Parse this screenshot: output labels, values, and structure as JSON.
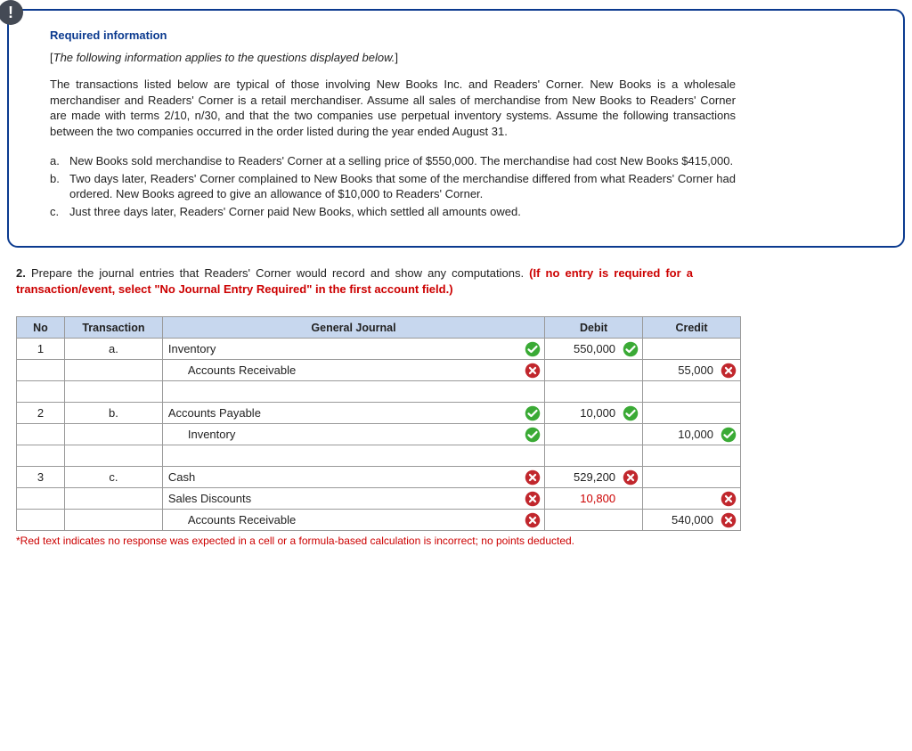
{
  "info": {
    "badge": "!",
    "heading": "Required information",
    "applies_prefix": "[",
    "applies": "The following information applies to the questions displayed below.",
    "applies_suffix": "]",
    "body": "The transactions listed below are typical of those involving New Books Inc. and Readers' Corner. New Books is a wholesale merchandiser and Readers' Corner is a retail merchandiser. Assume all sales of merchandise from New Books to Readers' Corner are made with terms 2/10, n/30, and that the two companies use perpetual inventory systems. Assume the following transactions between the two companies occurred in the order listed during the year ended August 31.",
    "items": [
      {
        "mk": "a.",
        "text": "New Books sold merchandise to Readers' Corner at a selling price of $550,000. The merchandise had cost New Books $415,000."
      },
      {
        "mk": "b.",
        "text": "Two days later, Readers' Corner complained to New Books that some of the merchandise differed from what Readers' Corner had ordered. New Books agreed to give an allowance of $10,000 to Readers' Corner."
      },
      {
        "mk": "c.",
        "text": "Just three days later, Readers' Corner paid New Books, which settled all amounts owed."
      }
    ]
  },
  "question": {
    "num": "2.",
    "text": "Prepare the journal entries that Readers' Corner would record and show any computations. ",
    "hint": "(If no entry is required for a transaction/event, select \"No Journal Entry Required\" in the first account field.)"
  },
  "table": {
    "headers": {
      "no": "No",
      "tx": "Transaction",
      "gj": "General Journal",
      "debit": "Debit",
      "credit": "Credit"
    },
    "rows": [
      {
        "no": "1",
        "tx": "a.",
        "account": "Inventory",
        "indent": false,
        "gmark": "check",
        "debit": "550,000",
        "dmark": "check",
        "credit": "",
        "cmark": ""
      },
      {
        "no": "",
        "tx": "",
        "account": "Accounts Receivable",
        "indent": true,
        "gmark": "x",
        "debit": "",
        "dmark": "",
        "credit": "55,000",
        "cmark": "x"
      },
      {
        "no": "",
        "tx": "",
        "account": "",
        "indent": false,
        "gmark": "",
        "debit": "",
        "dmark": "",
        "credit": "",
        "cmark": ""
      },
      {
        "no": "2",
        "tx": "b.",
        "account": "Accounts Payable",
        "indent": false,
        "gmark": "check",
        "debit": "10,000",
        "dmark": "check",
        "credit": "",
        "cmark": ""
      },
      {
        "no": "",
        "tx": "",
        "account": "Inventory",
        "indent": true,
        "gmark": "check",
        "debit": "",
        "dmark": "",
        "credit": "10,000",
        "cmark": "check"
      },
      {
        "no": "",
        "tx": "",
        "account": "",
        "indent": false,
        "gmark": "",
        "debit": "",
        "dmark": "",
        "credit": "",
        "cmark": ""
      },
      {
        "no": "3",
        "tx": "c.",
        "account": "Cash",
        "indent": false,
        "gmark": "x",
        "debit": "529,200",
        "dmark": "x",
        "credit": "",
        "cmark": ""
      },
      {
        "no": "",
        "tx": "",
        "account": "Sales Discounts",
        "indent": false,
        "gmark": "x",
        "debit": "10,800",
        "dred": true,
        "dmark": "",
        "credit": "",
        "cmark": "x"
      },
      {
        "no": "",
        "tx": "",
        "account": "Accounts Receivable",
        "indent": true,
        "gmark": "x",
        "debit": "",
        "dmark": "",
        "credit": "540,000",
        "cmark": "x"
      }
    ]
  },
  "footnote": "*Red text indicates no response was expected in a cell or a formula-based calculation is incorrect; no points deducted."
}
